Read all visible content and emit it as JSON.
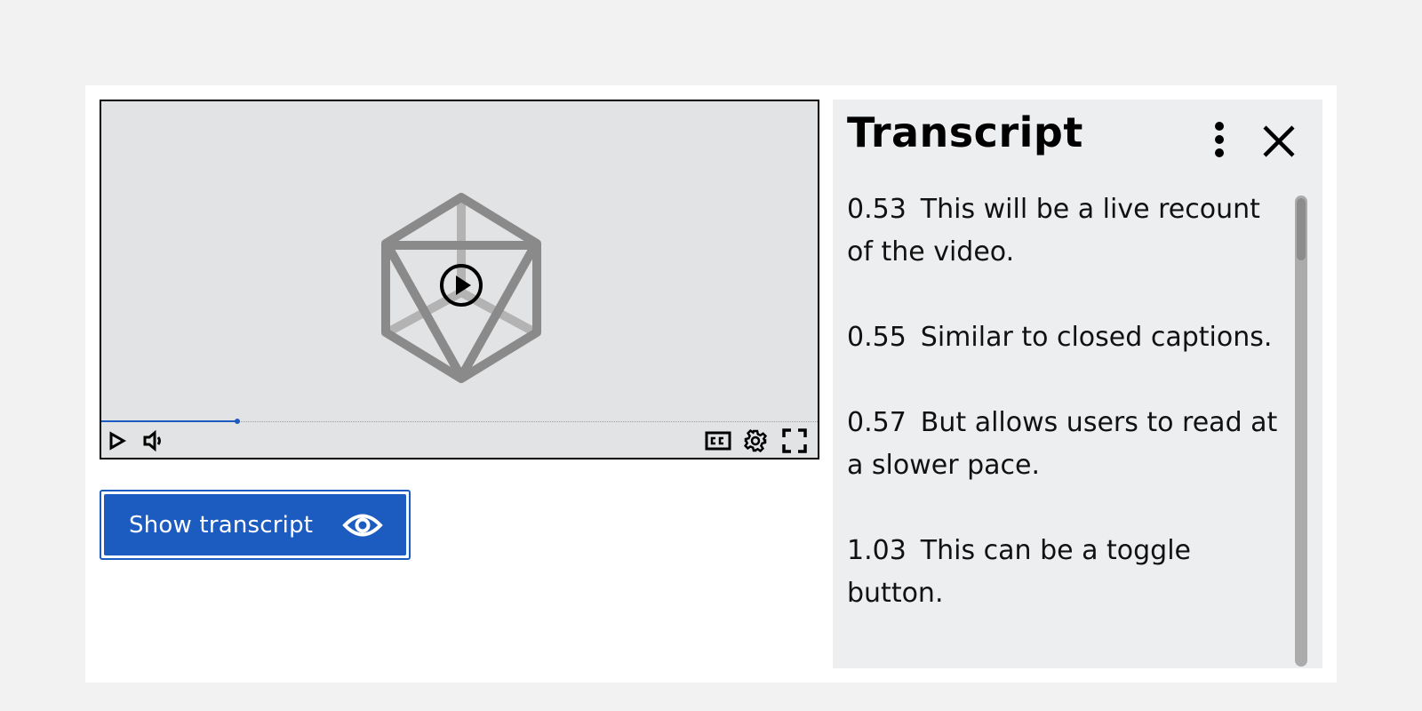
{
  "video": {
    "progress_fraction": 0.19,
    "controls": {
      "play_label": "Play",
      "volume_label": "Volume",
      "captions_label": "CC",
      "settings_label": "Settings",
      "fullscreen_label": "Fullscreen"
    }
  },
  "show_transcript_button": {
    "label": "Show transcript",
    "icon": "eye-icon"
  },
  "transcript": {
    "title": "Transcript",
    "entries": [
      {
        "time": "0.53",
        "text": "This will be a live recount of the video."
      },
      {
        "time": "0.55",
        "text": "Similar to closed captions."
      },
      {
        "time": "0.57",
        "text": "But allows users to read at a slower pace."
      },
      {
        "time": "1.03",
        "text": "This can be a toggle button."
      }
    ],
    "scroll_position_fraction": 0.0
  },
  "colors": {
    "accent": "#1c5bbf",
    "video_bg": "#e2e3e5",
    "panel_bg": "#edeef0",
    "page_bg": "#f2f2f2"
  }
}
